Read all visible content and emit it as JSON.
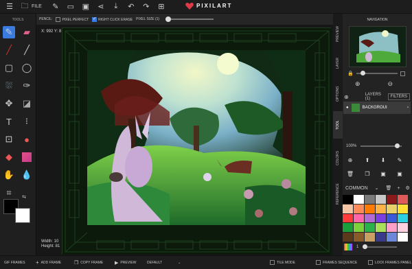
{
  "topbar": {
    "file_label": "FILE",
    "logo_text": "PIXILART"
  },
  "options": {
    "pencil_label": "PENCIL:",
    "pixel_perfect_label": "PIXEL PERFECT",
    "right_click_erase_label": "RIGHT CLICK ERASE",
    "pixel_size_label": "PIXEL SIZE (1)"
  },
  "tools_panel": {
    "title": "TOOLS"
  },
  "canvas_info": {
    "coords": "X: 992 Y: 8",
    "width": "Width: 10",
    "height": "Height: 81"
  },
  "right_panel": {
    "tabs": [
      "PREVIEW",
      "LAYER",
      "OPTIONS",
      "TOOL",
      "COLORS",
      "REFERENCE"
    ],
    "navigation_title": "NAVIGATION",
    "layers_label": "LAYERS (1)",
    "filters_label": "FILTERS",
    "layer_name": "BACKGROUI",
    "zoom": "100%",
    "palette_name": "COMMON",
    "brush_size": "1"
  },
  "palette_colors": [
    "#000000",
    "#ffffff",
    "#7a7a7a",
    "#c8c8c8",
    "#8b1a1a",
    "#e05a5a",
    "#f5c6a5",
    "#ff8b5a",
    "#ff7a00",
    "#ffb347",
    "#e8d06a",
    "#ffe135",
    "#ff3b3b",
    "#ff66aa",
    "#b36bd4",
    "#7b3fe0",
    "#3a5bd9",
    "#2dd0e0",
    "#1a9e3a",
    "#7bd13a",
    "#2ab24a",
    "#a8e05a",
    "#ff9ec8",
    "#ffd1e0",
    "#5a3a1a",
    "#8b5a2b",
    "#c8a064",
    "#3a3a8b",
    "#6a8ad9",
    "#ffffff"
  ],
  "bottombar": {
    "gif_frames": "GIF FRAMES",
    "add_frame": "ADD FRAME",
    "copy_frame": "COPY FRAME",
    "preview": "PREVIEW",
    "default": "DEFAULT",
    "tile_mode": "TILE MODE",
    "frames_sequence": "FRAMES SEQUENCE",
    "lock_frames_panel": "LOCK FRAMES PANEL"
  },
  "colors": {
    "accent": "#3a7be0",
    "primary": "#000000",
    "secondary": "#ffffff"
  }
}
